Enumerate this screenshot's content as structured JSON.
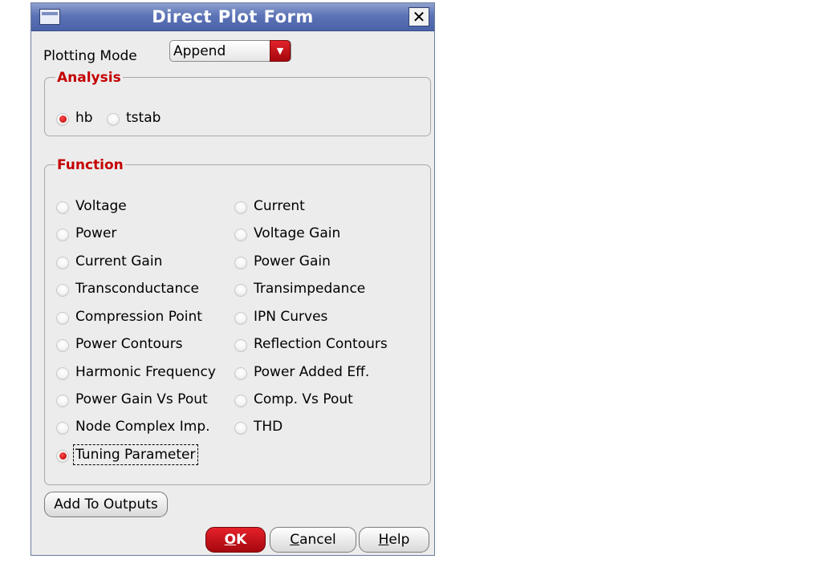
{
  "window": {
    "title": "Direct Plot Form",
    "close_label": "✕"
  },
  "plotting_mode": {
    "label": "Plotting Mode",
    "value": "Append"
  },
  "analysis": {
    "legend": "Analysis",
    "options": [
      {
        "label": "hb",
        "selected": true
      },
      {
        "label": "tstab",
        "selected": false
      }
    ]
  },
  "function": {
    "legend": "Function",
    "left": [
      {
        "label": "Voltage",
        "selected": false
      },
      {
        "label": "Power",
        "selected": false
      },
      {
        "label": "Current Gain",
        "selected": false
      },
      {
        "label": "Transconductance",
        "selected": false
      },
      {
        "label": "Compression Point",
        "selected": false
      },
      {
        "label": "Power Contours",
        "selected": false
      },
      {
        "label": "Harmonic Frequency",
        "selected": false
      },
      {
        "label": "Power Gain Vs Pout",
        "selected": false
      },
      {
        "label": "Node Complex Imp.",
        "selected": false
      },
      {
        "label": "Tuning Parameter",
        "selected": true
      }
    ],
    "right": [
      {
        "label": "Current",
        "selected": false
      },
      {
        "label": "Voltage Gain",
        "selected": false
      },
      {
        "label": "Power Gain",
        "selected": false
      },
      {
        "label": "Transimpedance",
        "selected": false
      },
      {
        "label": "IPN Curves",
        "selected": false
      },
      {
        "label": "Reflection Contours",
        "selected": false
      },
      {
        "label": "Power Added Eff.",
        "selected": false
      },
      {
        "label": "Comp. Vs Pout",
        "selected": false
      },
      {
        "label": "THD",
        "selected": false
      }
    ]
  },
  "buttons": {
    "add_to_outputs": "Add To Outputs",
    "ok_underline": "O",
    "ok_rest": "K",
    "cancel_underline": "C",
    "cancel_rest": "ancel",
    "help_underline": "H",
    "help_rest": "elp"
  },
  "colors": {
    "accent_red": "#c40000",
    "title_blue": "#5c73b6"
  }
}
